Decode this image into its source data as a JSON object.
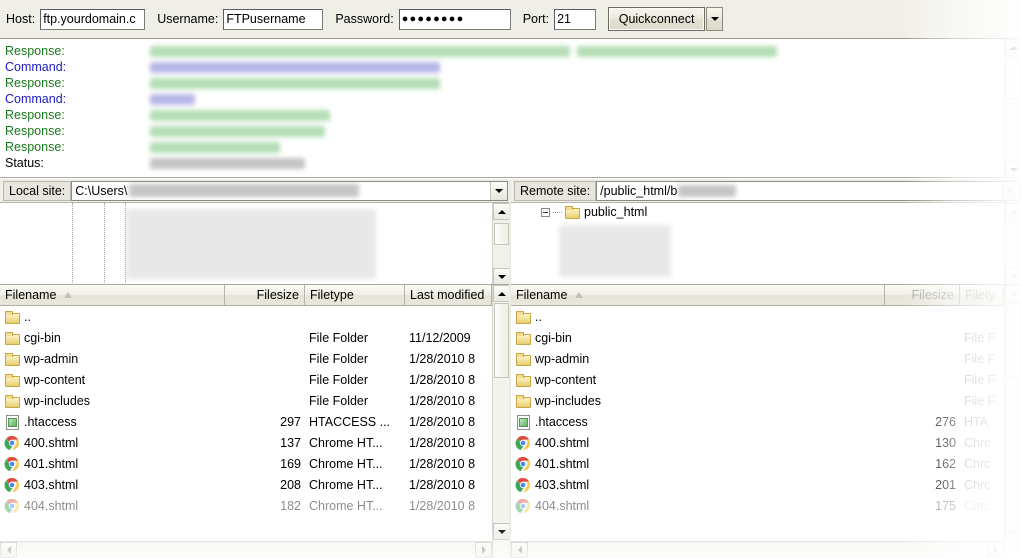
{
  "quickconnect": {
    "host_label": "Host:",
    "host_value": "ftp.yourdomain.c",
    "username_label": "Username:",
    "username_value": "FTPusername",
    "password_label": "Password:",
    "password_value": "●●●●●●●●",
    "port_label": "Port:",
    "port_value": "21",
    "connect_button": "Quickconnect",
    "dropdown_icon": "chevron-down-icon"
  },
  "log": {
    "entries": [
      {
        "tag": "Response:",
        "kind": "response",
        "segments": [
          420,
          200
        ]
      },
      {
        "tag": "Command:",
        "kind": "command",
        "segments": [
          290
        ]
      },
      {
        "tag": "Response:",
        "kind": "response",
        "segments": [
          290
        ]
      },
      {
        "tag": "Command:",
        "kind": "command",
        "segments": [
          45
        ]
      },
      {
        "tag": "Response:",
        "kind": "response",
        "segments": [
          180
        ]
      },
      {
        "tag": "Response:",
        "kind": "response",
        "segments": [
          175
        ]
      },
      {
        "tag": "Response:",
        "kind": "response",
        "segments": [
          130
        ]
      },
      {
        "tag": "Status:",
        "kind": "status",
        "segments": [
          155
        ]
      }
    ]
  },
  "local": {
    "site_label": "Local site:",
    "site_value": "C:\\Users\\",
    "columns": [
      "Filename",
      "Filesize",
      "Filetype",
      "Last modified"
    ],
    "sort_column": "Filename",
    "sort_direction": "ascending",
    "rows": [
      {
        "icon": "folder-icon",
        "name": "..",
        "size": "",
        "type": "",
        "modified": ""
      },
      {
        "icon": "folder-icon",
        "name": "cgi-bin",
        "size": "",
        "type": "File Folder",
        "modified": "11/12/2009"
      },
      {
        "icon": "folder-icon",
        "name": "wp-admin",
        "size": "",
        "type": "File Folder",
        "modified": "1/28/2010 8"
      },
      {
        "icon": "folder-icon",
        "name": "wp-content",
        "size": "",
        "type": "File Folder",
        "modified": "1/28/2010 8"
      },
      {
        "icon": "folder-icon",
        "name": "wp-includes",
        "size": "",
        "type": "File Folder",
        "modified": "1/28/2010 8"
      },
      {
        "icon": "document-icon",
        "name": ".htaccess",
        "size": "297",
        "type": "HTACCESS ...",
        "modified": "1/28/2010 8"
      },
      {
        "icon": "chrome-icon",
        "name": "400.shtml",
        "size": "137",
        "type": "Chrome HT...",
        "modified": "1/28/2010 8"
      },
      {
        "icon": "chrome-icon",
        "name": "401.shtml",
        "size": "169",
        "type": "Chrome HT...",
        "modified": "1/28/2010 8"
      },
      {
        "icon": "chrome-icon",
        "name": "403.shtml",
        "size": "208",
        "type": "Chrome HT...",
        "modified": "1/28/2010 8"
      },
      {
        "icon": "chrome-icon",
        "name": "404.shtml",
        "size": "182",
        "type": "Chrome HT...",
        "modified": "1/28/2010 8"
      }
    ]
  },
  "remote": {
    "site_label": "Remote site:",
    "site_value": "/public_html/b",
    "tree_root": "public_html",
    "columns": [
      "Filename",
      "Filesize",
      "Filety"
    ],
    "sort_column": "Filename",
    "sort_direction": "ascending",
    "rows": [
      {
        "icon": "folder-icon",
        "name": "..",
        "size": "",
        "type": ""
      },
      {
        "icon": "folder-icon",
        "name": "cgi-bin",
        "size": "",
        "type": "File F"
      },
      {
        "icon": "folder-icon",
        "name": "wp-admin",
        "size": "",
        "type": "File F"
      },
      {
        "icon": "folder-icon",
        "name": "wp-content",
        "size": "",
        "type": "File F"
      },
      {
        "icon": "folder-icon",
        "name": "wp-includes",
        "size": "",
        "type": "File F"
      },
      {
        "icon": "document-icon",
        "name": ".htaccess",
        "size": "276",
        "type": "HTA"
      },
      {
        "icon": "chrome-icon",
        "name": "400.shtml",
        "size": "130",
        "type": "Chrc"
      },
      {
        "icon": "chrome-icon",
        "name": "401.shtml",
        "size": "162",
        "type": "Chrc"
      },
      {
        "icon": "chrome-icon",
        "name": "403.shtml",
        "size": "201",
        "type": "Chrc"
      },
      {
        "icon": "chrome-icon",
        "name": "404.shtml",
        "size": "175",
        "type": "Chrc"
      }
    ]
  },
  "colors": {
    "response": "#1a7a1a",
    "command": "#2020c0",
    "status": "#000000",
    "toolbar_bg": "#f0efe7",
    "header_bg": "#efeee5",
    "disabled_text": "#a9a9a4"
  }
}
